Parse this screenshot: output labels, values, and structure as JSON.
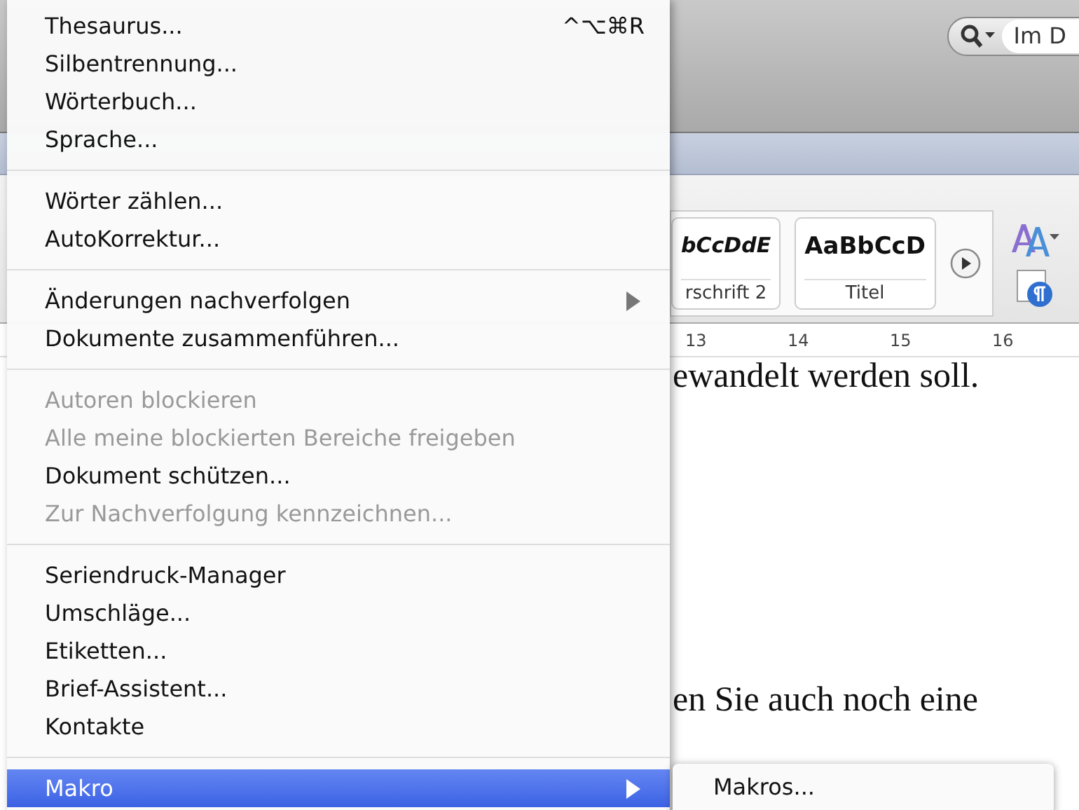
{
  "toolbar": {
    "search": {
      "value": "Im D"
    }
  },
  "ribbon": {
    "styles": [
      {
        "preview": "bCcDdE",
        "label": "rschrift 2",
        "kind": "italic"
      },
      {
        "preview": "AaBbCcD",
        "label": "Titel",
        "kind": "bold"
      }
    ]
  },
  "ruler": {
    "marks": [
      "13",
      "14",
      "15",
      "16"
    ]
  },
  "document": {
    "lines": [
      "ewandelt werden soll.",
      "en Sie auch noch eine"
    ]
  },
  "menu": {
    "groups": [
      [
        {
          "label": "Thesaurus...",
          "shortcut": "^⌥⌘R",
          "disabled": false,
          "has_submenu": false,
          "selected": false
        },
        {
          "label": "Silbentrennung...",
          "disabled": false,
          "has_submenu": false,
          "selected": false
        },
        {
          "label": "Wörterbuch...",
          "disabled": false,
          "has_submenu": false,
          "selected": false
        },
        {
          "label": "Sprache...",
          "disabled": false,
          "has_submenu": false,
          "selected": false
        }
      ],
      [
        {
          "label": "Wörter zählen...",
          "disabled": false,
          "has_submenu": false,
          "selected": false
        },
        {
          "label": "AutoKorrektur...",
          "disabled": false,
          "has_submenu": false,
          "selected": false
        }
      ],
      [
        {
          "label": "Änderungen nachverfolgen",
          "disabled": false,
          "has_submenu": true,
          "selected": false
        },
        {
          "label": "Dokumente zusammenführen...",
          "disabled": false,
          "has_submenu": false,
          "selected": false
        }
      ],
      [
        {
          "label": "Autoren blockieren",
          "disabled": true,
          "has_submenu": false,
          "selected": false
        },
        {
          "label": "Alle meine blockierten Bereiche freigeben",
          "disabled": true,
          "has_submenu": false,
          "selected": false
        },
        {
          "label": "Dokument schützen...",
          "disabled": false,
          "has_submenu": false,
          "selected": false
        },
        {
          "label": "Zur Nachverfolgung kennzeichnen...",
          "disabled": true,
          "has_submenu": false,
          "selected": false
        }
      ],
      [
        {
          "label": "Seriendruck-Manager",
          "disabled": false,
          "has_submenu": false,
          "selected": false
        },
        {
          "label": "Umschläge...",
          "disabled": false,
          "has_submenu": false,
          "selected": false
        },
        {
          "label": "Etiketten...",
          "disabled": false,
          "has_submenu": false,
          "selected": false
        },
        {
          "label": "Brief-Assistent...",
          "disabled": false,
          "has_submenu": false,
          "selected": false
        },
        {
          "label": "Kontakte",
          "disabled": false,
          "has_submenu": false,
          "selected": false
        }
      ],
      [
        {
          "label": "Makro",
          "disabled": false,
          "has_submenu": true,
          "selected": true
        }
      ]
    ]
  },
  "submenu": {
    "items": [
      {
        "label": "Makros...",
        "selected": false
      }
    ]
  }
}
